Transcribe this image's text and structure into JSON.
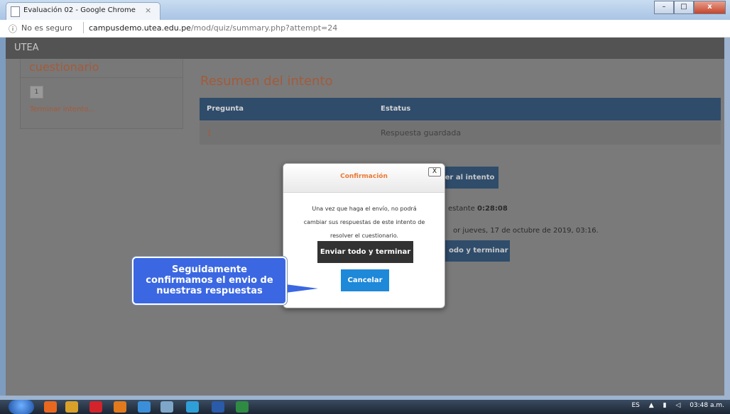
{
  "browser": {
    "tab_title": "Evaluación 02 - Google Chrome",
    "security_label": "No es seguro",
    "url_host": "campusdemo.utea.edu.pe",
    "url_path": "/mod/quiz/summary.php?attempt=24",
    "window_buttons": [
      "–",
      "□",
      "x"
    ]
  },
  "site": {
    "brand": "UTEA"
  },
  "sidebar": {
    "title": "cuestionario",
    "question_box": "1",
    "finish_link": "Terminar intento..."
  },
  "summary": {
    "title": "Resumen del intento",
    "columns": [
      "Pregunta",
      "Estatus"
    ],
    "rows": [
      {
        "question": "1",
        "status": "Respuesta guardada"
      }
    ],
    "back_button": "Volver al intento",
    "time_prefix": "estante",
    "time_value": "0:28:08",
    "deadline_text": "or jueves, 17 de octubre de 2019, 03:16.",
    "submit_partial": "odo y terminar"
  },
  "dialog": {
    "title": "Confirmación",
    "close_label": "X",
    "message_lines": [
      "Una vez que haga el envío, no podrá",
      "cambiar sus respuestas de este intento de",
      "resolver el cuestionario."
    ],
    "submit_button": "Enviar todo y terminar",
    "cancel_button": "Cancelar"
  },
  "callout": {
    "lines": [
      "Seguidamente",
      "confirmamos  el envio de",
      "nuestras respuestas"
    ]
  },
  "taskbar": {
    "language": "ES",
    "clock": "03:48 a.m."
  },
  "colors": {
    "accent": "#a35b3a",
    "dialog_title": "#ea7a33",
    "cancel": "#1e88d9",
    "callout": "#3b67e2",
    "table_head": "#2f4c6b"
  }
}
